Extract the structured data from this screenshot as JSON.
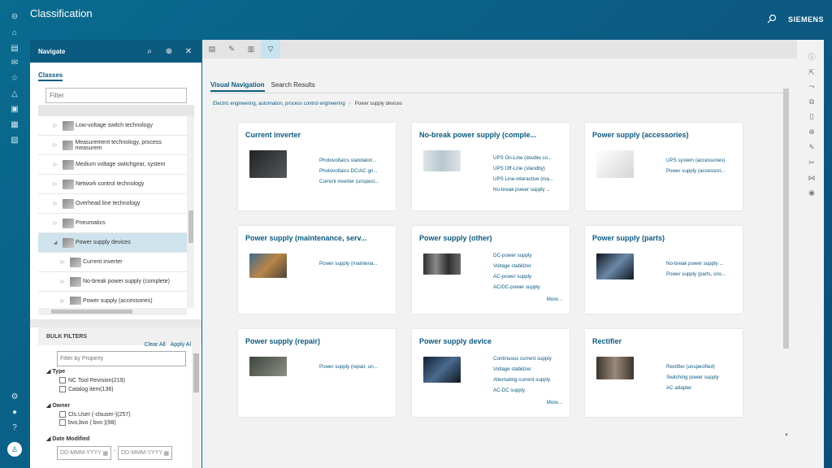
{
  "header": {
    "title": "Classification",
    "brand": "SIEMENS",
    "search_icon": "search-icon"
  },
  "rail": {
    "icons": [
      "back-icon",
      "home-icon",
      "inbox-icon",
      "mail-icon",
      "star-icon",
      "alert-icon",
      "change-icon",
      "schedule-icon",
      "report-icon"
    ],
    "bottom_icons": [
      "settings-icon",
      "chat-icon",
      "help-icon"
    ]
  },
  "navigate": {
    "title": "Navigate",
    "tab": "Classes",
    "filter_placeholder": "Filter",
    "tree": [
      {
        "label": "Low-voltage switch technology",
        "level": 0,
        "selected": false
      },
      {
        "label": "Measurement technology, process measurem",
        "level": 0,
        "selected": false
      },
      {
        "label": "Medium voltage switchgear, system",
        "level": 0,
        "selected": false
      },
      {
        "label": "Network control technology",
        "level": 0,
        "selected": false
      },
      {
        "label": "Overhead line technology",
        "level": 0,
        "selected": false
      },
      {
        "label": "Pneumatics",
        "level": 0,
        "selected": false
      },
      {
        "label": "Power supply devices",
        "level": 0,
        "selected": true
      },
      {
        "label": "Current inverter",
        "level": 1,
        "selected": false
      },
      {
        "label": "No-break power supply (complete)",
        "level": 1,
        "selected": false
      },
      {
        "label": "Power supply (accessories)",
        "level": 1,
        "selected": false
      }
    ],
    "bulk": {
      "title": "BULK FILTERS",
      "clear_all": "Clear All",
      "apply_all": "Apply Al",
      "property_placeholder": "Filter by Property",
      "type": {
        "title": "Type",
        "options": [
          "NC Tool Revision(219)",
          "Catalog item(136)"
        ]
      },
      "owner": {
        "title": "Owner",
        "options": [
          "Cls.User (-clsuser-)(257)",
          "bvo,bvo ( bvo )(98)"
        ]
      },
      "date": {
        "title": "Date Modified",
        "from": "DD-MMM-YYYY",
        "dash": "-",
        "to": "DD-MMM-YYYY"
      }
    }
  },
  "main": {
    "tabs": [
      "Visual Navigation",
      "Search Results"
    ],
    "breadcrumb": [
      "Electric engineering, automation, process control engineering",
      "Power supply devices"
    ],
    "more": "More...",
    "cards": [
      {
        "title": "Current inverter",
        "links": [
          "Photovoltaics standalon...",
          "Photovoltaics DC/AC gri...",
          "Current inverter (unspeci..."
        ],
        "more": false,
        "thumb": "#2d3033"
      },
      {
        "title": "No-break power supply (comple...",
        "links": [
          "UPS On-Line (double co...",
          "UPS Off-Line (standby)",
          "UPS Line-interactive (ma...",
          "No-break power supply ..."
        ],
        "more": false,
        "thumb": "#c8d2d8"
      },
      {
        "title": "Power supply (accessories)",
        "links": [
          "UPS system (accessories)",
          "Power supply (accessori..."
        ],
        "more": false,
        "thumb": "#e4e4e4"
      },
      {
        "title": "Power supply (maintenance, serv...",
        "links": [
          "Power supply (maintena..."
        ],
        "more": false,
        "thumb": "#7a6a52"
      },
      {
        "title": "Power supply (other)",
        "links": [
          "DC-power supply",
          "Voltage stabilizer",
          "AC-power supply",
          "AC/DC-power supply"
        ],
        "more": true,
        "thumb": "#4a4a4a"
      },
      {
        "title": "Power supply (parts)",
        "links": [
          "No-break power supply ...",
          "Power supply (parts, uns..."
        ],
        "more": false,
        "thumb": "#1d2a3a"
      },
      {
        "title": "Power supply (repair)",
        "links": [
          "Power supply (repair, un..."
        ],
        "more": false,
        "thumb": "#555b55"
      },
      {
        "title": "Power supply device",
        "links": [
          "Continuous current supply",
          "Voltage stabilizer",
          "Alternating current supply",
          "AC-DC supply"
        ],
        "more": true,
        "thumb": "#2e4158"
      },
      {
        "title": "Rectifier",
        "links": [
          "Rectifier (unspecified)",
          "Switching power supply",
          "AC adapter"
        ],
        "more": false,
        "thumb": "#5a5048"
      }
    ]
  },
  "right_rail": {
    "icons": [
      "info-icon",
      "export-icon",
      "share-icon",
      "copy-icon",
      "paste-icon",
      "add-icon",
      "edit-icon",
      "tools-icon",
      "network-icon",
      "view-icon"
    ]
  }
}
